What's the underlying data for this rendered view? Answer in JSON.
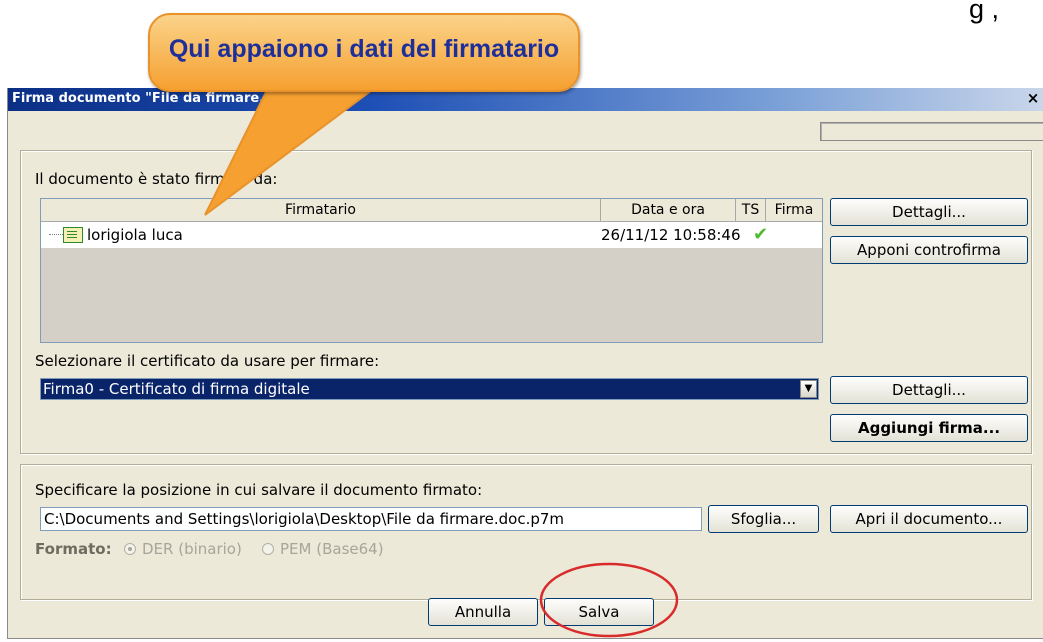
{
  "top_fragment": "g ,",
  "callout": {
    "text": "Qui appaiono i dati del firmatario"
  },
  "window": {
    "title": "Firma documento \"File da firmare.doc\"",
    "close_glyph": "×"
  },
  "signed_section": {
    "label": "Il documento è stato firmato da:",
    "columns": [
      "Firmatario",
      "Data e ora",
      "TS",
      "Firma"
    ],
    "rows": [
      {
        "signer": "lorigiola luca",
        "datetime": "26/11/12 10:58:46",
        "ts": "",
        "firma_icon": "check-icon"
      }
    ],
    "details_button": "Dettagli...",
    "countersign_button": "Apponi controfirma"
  },
  "certificate_section": {
    "label": "Selezionare il certificato da usare per firmare:",
    "selected": "Firma0 - Certificato di firma digitale",
    "details_button": "Dettagli...",
    "add_signature_button": "Aggiungi firma..."
  },
  "save_section": {
    "label": "Specificare la posizione in cui salvare il documento firmato:",
    "path": "C:\\Documents and Settings\\lorigiola\\Desktop\\File da firmare.doc.p7m",
    "browse_button": "Sfoglia...",
    "open_button": "Apri il documento...",
    "format_label": "Formato:",
    "format_options": [
      "DER (binario)",
      "PEM (Base64)"
    ],
    "format_selected": "DER (binario)"
  },
  "footer": {
    "cancel_button": "Annulla",
    "save_button": "Salva"
  },
  "colors": {
    "callout_fill": "#f5a030",
    "callout_text": "#1e2f9a",
    "highlight_ellipse": "#d92b2b",
    "selection": "#0a246a",
    "check": "#4cbb2e"
  }
}
